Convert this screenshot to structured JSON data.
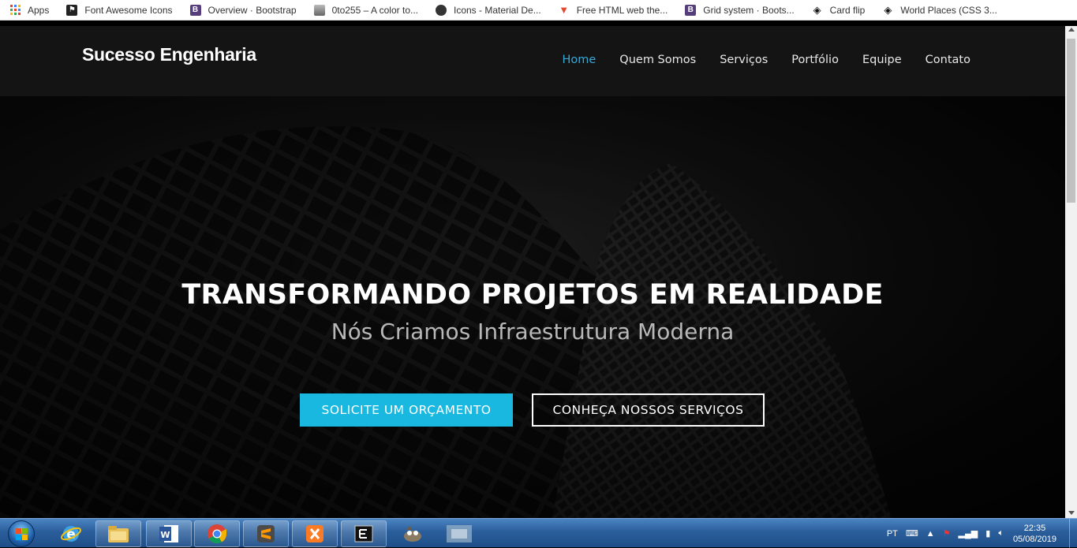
{
  "bookmarks": [
    {
      "label": "Apps",
      "icon": "apps-grid-icon"
    },
    {
      "label": "Font Awesome Icons",
      "icon": "flag-icon"
    },
    {
      "label": "Overview · Bootstrap",
      "icon": "bootstrap-icon"
    },
    {
      "label": "0to255 – A color to...",
      "icon": "page-icon"
    },
    {
      "label": "Icons - Material De...",
      "icon": "material-icon"
    },
    {
      "label": "Free HTML web the...",
      "icon": "free-html-icon"
    },
    {
      "label": "Grid system · Boots...",
      "icon": "bootstrap-icon"
    },
    {
      "label": "Card flip",
      "icon": "codepen-icon"
    },
    {
      "label": "World Places (CSS 3...",
      "icon": "codepen-icon"
    }
  ],
  "site": {
    "brand": "Sucesso Engenharia",
    "nav": [
      "Home",
      "Quem Somos",
      "Serviços",
      "Portfólio",
      "Equipe",
      "Contato"
    ],
    "active_nav": "Home",
    "hero_title": "TRANSFORMANDO PROJETOS EM REALIDADE",
    "hero_subtitle": "Nós Criamos Infraestrutura Moderna",
    "cta_primary": "SOLICITE UM ORÇAMENTO",
    "cta_secondary": "CONHEÇA NOSSOS SERVIÇOS"
  },
  "colors": {
    "accent": "#19b8e0",
    "nav_active": "#39a9d9",
    "navbar_bg": "#141414"
  },
  "taskbar": {
    "apps": [
      "internet-explorer-icon",
      "file-explorer-icon",
      "word-icon",
      "chrome-icon",
      "sublime-text-icon",
      "xampp-icon",
      "terminal-icon",
      "gimp-icon",
      "app-thumbnail-icon"
    ],
    "language": "PT",
    "time": "22:35",
    "date": "05/08/2019"
  }
}
